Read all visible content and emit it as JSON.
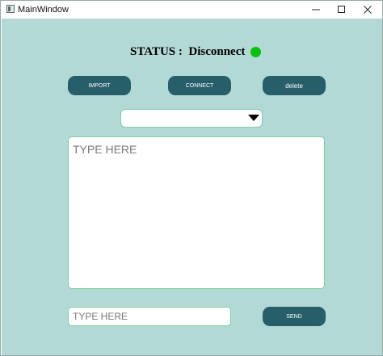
{
  "window": {
    "title": "MainWindow"
  },
  "status": {
    "label": "STATUS :  Disconnect",
    "indicator_color": "#09c00f"
  },
  "buttons": {
    "import": "IMPORT",
    "connect": "CONNECT",
    "delete": "delete",
    "send": "SEND"
  },
  "combo": {
    "selected": ""
  },
  "message_area": {
    "placeholder": "TYPE HERE"
  },
  "message_input": {
    "placeholder": "TYPE HERE"
  },
  "colors": {
    "background": "#b2d9d5",
    "button": "#265e6a",
    "field_border": "#7fcf9a"
  },
  "icons": {
    "app": "app-window-icon",
    "minimize": "minimize-icon",
    "maximize": "maximize-icon",
    "close": "close-icon",
    "dropdown": "dropdown-arrow-icon"
  }
}
